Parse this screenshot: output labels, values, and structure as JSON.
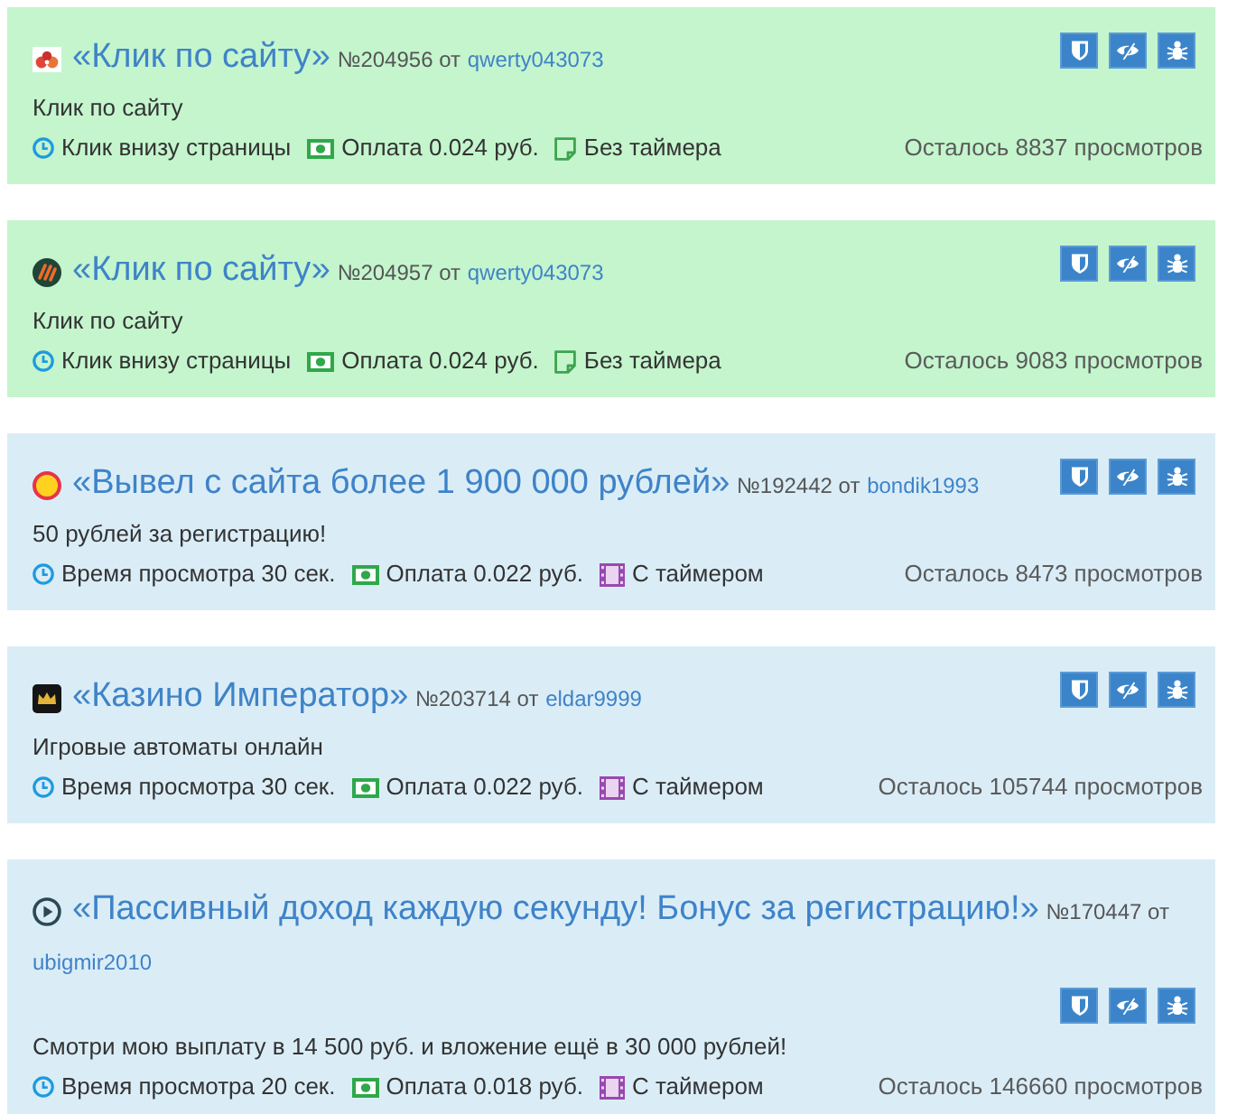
{
  "cards": [
    {
      "kind": "click",
      "title": "«Клик по сайту»",
      "number": "№204956 от",
      "author": "qwerty043073",
      "description": "Клик по сайту",
      "meta": [
        {
          "kind": "clock",
          "text": "Клик внизу страницы"
        },
        {
          "kind": "money",
          "text": "Оплата 0.024 руб."
        },
        {
          "kind": "note",
          "text": "Без таймера"
        }
      ],
      "remaining": "Осталось 8837 просмотров"
    },
    {
      "kind": "click",
      "title": "«Клик по сайту»",
      "number": "№204957 от",
      "author": "qwerty043073",
      "description": "Клик по сайту",
      "meta": [
        {
          "kind": "clock",
          "text": "Клик внизу страницы"
        },
        {
          "kind": "money",
          "text": "Оплата 0.024 руб."
        },
        {
          "kind": "note",
          "text": "Без таймера"
        }
      ],
      "remaining": "Осталось 9083 просмотров"
    },
    {
      "kind": "view",
      "title": "«Вывел с сайта более 1 900 000 рублей»",
      "number": "№192442 от",
      "author": "bondik1993",
      "description": "50 рублей за регистрацию!",
      "meta": [
        {
          "kind": "clock",
          "text": "Время просмотра 30 сек."
        },
        {
          "kind": "money",
          "text": "Оплата 0.022 руб."
        },
        {
          "kind": "film",
          "text": "С таймером"
        }
      ],
      "remaining": "Осталось 8473 просмотров"
    },
    {
      "kind": "view",
      "title": "«Казино Император»",
      "number": "№203714 от",
      "author": "eldar9999",
      "description": "Игровые автоматы онлайн",
      "meta": [
        {
          "kind": "clock",
          "text": "Время просмотра 30 сек."
        },
        {
          "kind": "money",
          "text": "Оплата 0.022 руб."
        },
        {
          "kind": "film",
          "text": "С таймером"
        }
      ],
      "remaining": "Осталось 105744 просмотров"
    },
    {
      "kind": "view",
      "title": "«Пассивный доход каждую секунду! Бонус за регистрацию!»",
      "number": "№170447 от",
      "author": "ubigmir2010",
      "description": "Смотри мою выплату в 14 500 руб. и вложение ещё в 30 000 рублей!",
      "meta": [
        {
          "kind": "clock",
          "text": "Время просмотра 20 сек."
        },
        {
          "kind": "money",
          "text": "Оплата 0.018 руб."
        },
        {
          "kind": "film",
          "text": "С таймером"
        }
      ],
      "remaining": "Осталось 146660 просмотров"
    }
  ]
}
